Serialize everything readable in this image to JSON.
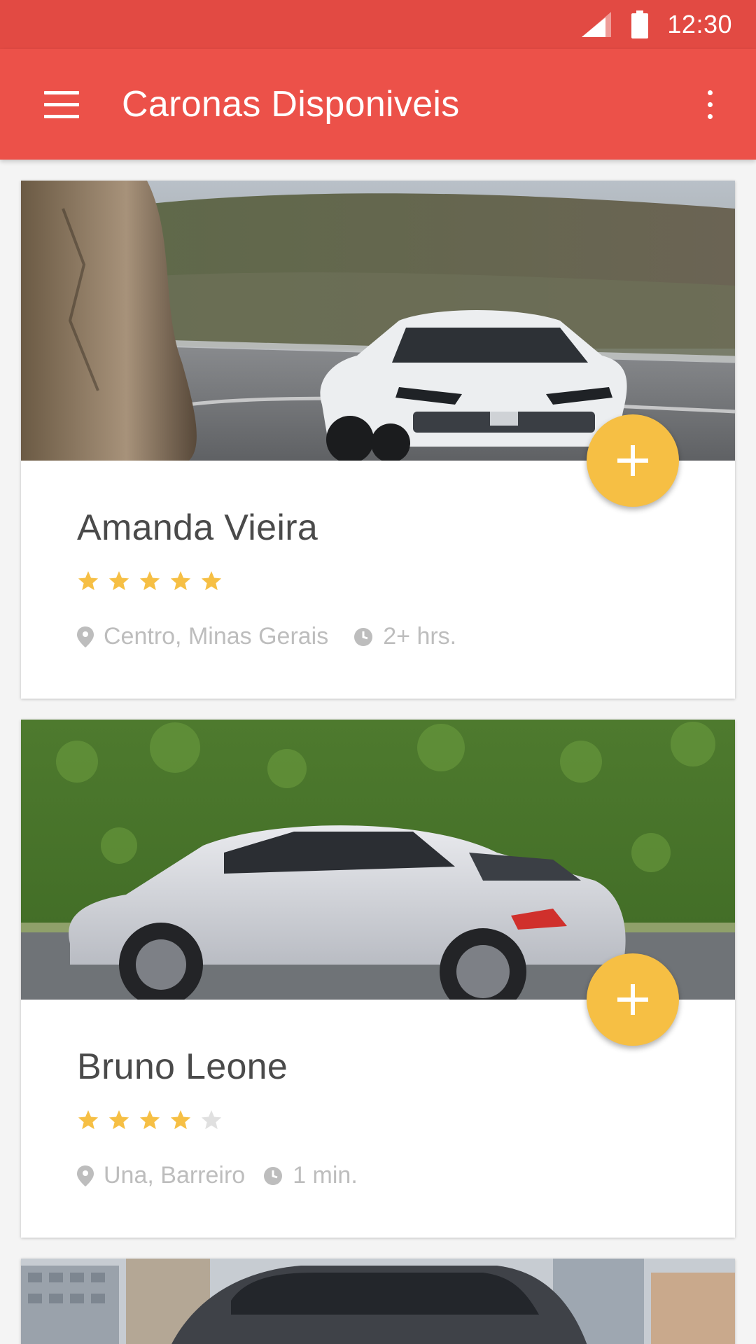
{
  "status_bar": {
    "time": "12:30",
    "icons": [
      "signal-icon",
      "battery-icon"
    ]
  },
  "app_bar": {
    "title": "Caronas Disponiveis",
    "icons": [
      "menu-icon",
      "more-vert-icon"
    ]
  },
  "colors": {
    "status_bar": "#e24a43",
    "app_bar": "#ec5149",
    "fab": "#f6bf44",
    "star_filled": "#f6bf44",
    "star_empty": "#e0e0e0",
    "meta_text": "#bdbdbd"
  },
  "rides": [
    {
      "driver": "Amanda Vieira",
      "rating": 5,
      "max_rating": 5,
      "location": "Centro, Minas Gerais",
      "time": "2+ hrs.",
      "fab_icon": "add-icon"
    },
    {
      "driver": "Bruno Leone",
      "rating": 4,
      "max_rating": 5,
      "location": "Una, Barreiro",
      "time": "1 min.",
      "fab_icon": "add-icon"
    },
    {
      "driver": "",
      "rating": null,
      "location": "",
      "time": ""
    }
  ]
}
